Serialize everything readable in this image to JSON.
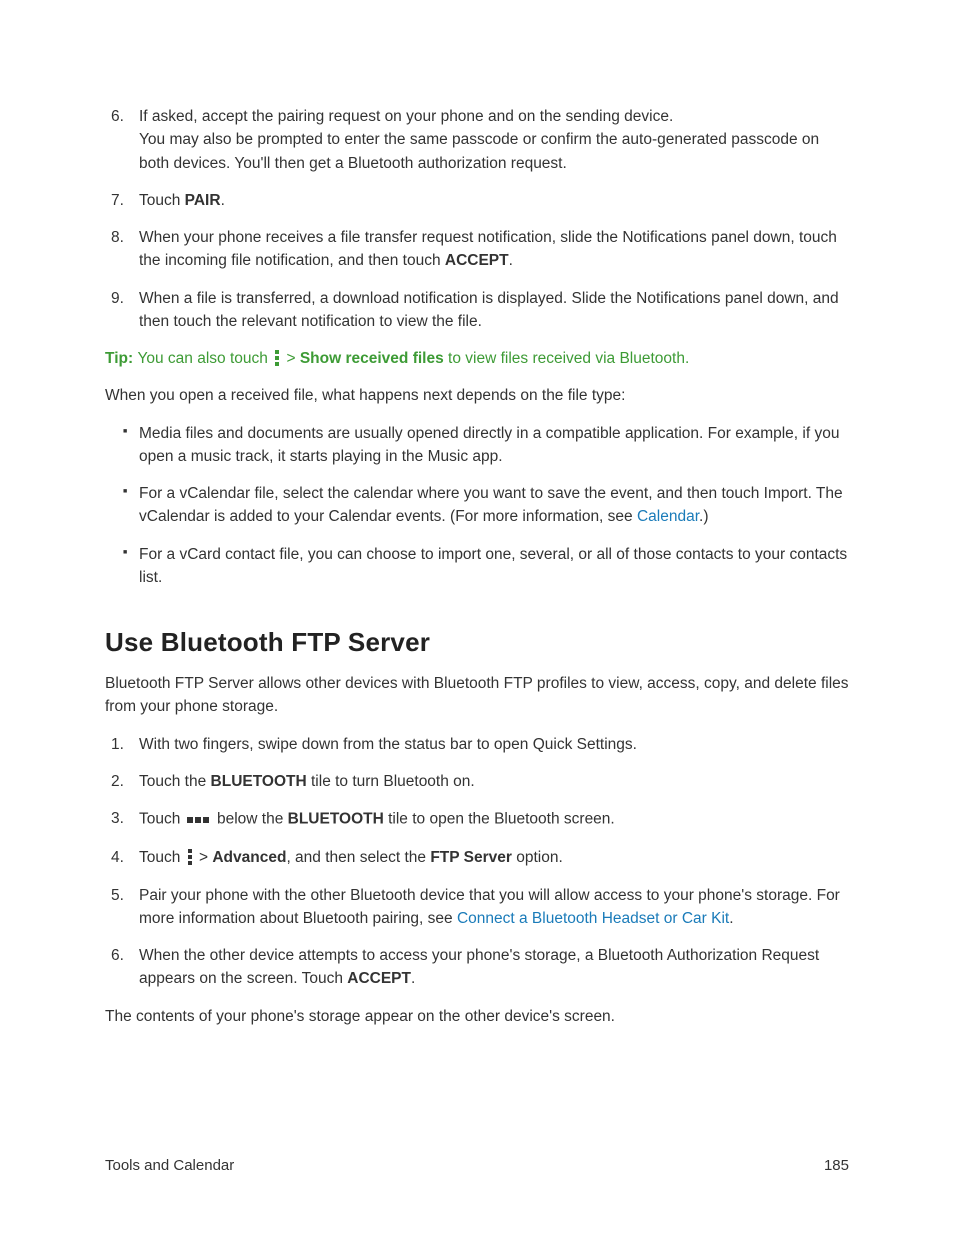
{
  "steps_a": {
    "s6_a": "If asked, accept the pairing request on your phone and on the sending device.",
    "s6_b": "You may also be prompted to enter the same passcode or confirm the auto-generated passcode on both devices. You'll then get a Bluetooth authorization request.",
    "s7_a": "Touch ",
    "s7_b": "PAIR",
    "s7_c": ".",
    "s8_a": "When your phone receives a file transfer request notification, slide the Notifications panel down, touch the incoming file notification, and then touch ",
    "s8_b": "ACCEPT",
    "s8_c": ".",
    "s9": "When a file is transferred, a download notification is displayed. Slide the Notifications panel down, and then touch the relevant notification to view the file."
  },
  "tip": {
    "label": "Tip: ",
    "a": "You can also touch ",
    "b": " > ",
    "c": "Show received files",
    "d": " to view files received via Bluetooth."
  },
  "para1": "When you open a received file, what happens next depends on the file type:",
  "bullets": {
    "b1": "Media files and documents are usually opened directly in a compatible application. For example, if you open a music track, it starts playing in the Music app.",
    "b2_a": "For a vCalendar file, select the calendar where you want to save the event, and then touch Import. The vCalendar is added to your Calendar events. (For more information, see ",
    "b2_link": "Calendar",
    "b2_b": ".)",
    "b3": "For a vCard contact file, you can choose to import one, several, or all of those contacts to your contacts list."
  },
  "heading": "Use Bluetooth FTP Server",
  "para2": "Bluetooth FTP Server allows other devices with Bluetooth FTP profiles to view, access, copy, and delete files from your phone storage.",
  "steps_b": {
    "s1": "With two fingers, swipe down from the status bar to open Quick Settings.",
    "s2_a": "Touch the ",
    "s2_b": "BLUETOOTH",
    "s2_c": " tile to turn Bluetooth on.",
    "s3_a": "Touch ",
    "s3_b": " below the ",
    "s3_c": "BLUETOOTH",
    "s3_d": " tile to open the Bluetooth screen.",
    "s4_a": "Touch ",
    "s4_b": " > ",
    "s4_c": "Advanced",
    "s4_d": ", and then select the ",
    "s4_e": "FTP Server",
    "s4_f": " option.",
    "s5_a": "Pair your phone with the other Bluetooth device that you will allow access to your phone's storage. For more information about Bluetooth pairing, see ",
    "s5_link": "Connect a Bluetooth Headset or Car Kit",
    "s5_b": ".",
    "s6_a2": "When the other device attempts to access your phone's storage, a Bluetooth Authorization Request appears on the screen. Touch ",
    "s6_b2": "ACCEPT",
    "s6_c2": "."
  },
  "para3": "The contents of your phone's storage appear on the other device's screen.",
  "footer": {
    "left": "Tools and Calendar",
    "right": "185"
  }
}
